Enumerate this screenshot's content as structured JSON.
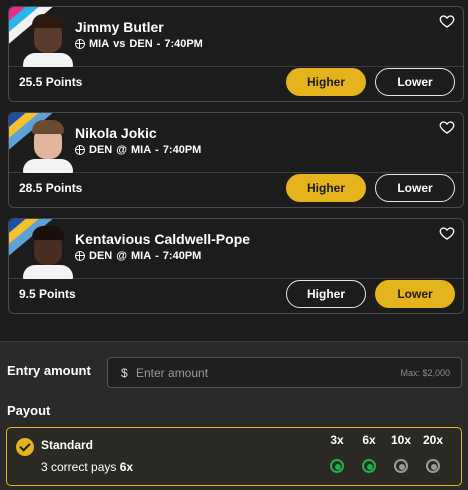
{
  "players": [
    {
      "name": "Jimmy Butler",
      "team": "MIA",
      "sep": "vs",
      "opponent": "DEN",
      "time": "7:40PM",
      "points": "25.5 Points",
      "higher_label": "Higher",
      "lower_label": "Lower",
      "selected": "higher",
      "stripe_colors": [
        "#e62f8a",
        "#29b6e8",
        "#f2f2f2"
      ],
      "skin": "#5a3a2a",
      "hair": "#2a1a12",
      "shirt": "#f4f4f4"
    },
    {
      "name": "Nikola Jokic",
      "team": "DEN",
      "sep": "@",
      "opponent": "MIA",
      "time": "7:40PM",
      "points": "28.5 Points",
      "higher_label": "Higher",
      "lower_label": "Lower",
      "selected": "higher",
      "stripe_colors": [
        "#1d4fa8",
        "#f2c230",
        "#5ea0d8"
      ],
      "skin": "#e2b59a",
      "hair": "#6a4a32",
      "shirt": "#f4f4f4"
    },
    {
      "name": "Kentavious Caldwell-Pope",
      "team": "DEN",
      "sep": "@",
      "opponent": "MIA",
      "time": "7:40PM",
      "points": "9.5 Points",
      "higher_label": "Higher",
      "lower_label": "Lower",
      "selected": "lower",
      "stripe_colors": [
        "#1d4fa8",
        "#f2c230",
        "#5ea0d8"
      ],
      "skin": "#4a2e22",
      "hair": "#1a100c",
      "shirt": "#f4f4f4"
    }
  ],
  "entry": {
    "label": "Entry amount",
    "currency": "$",
    "placeholder": "Enter amount",
    "max": "Max: $2,000"
  },
  "payout": {
    "label": "Payout",
    "plan": "Standard",
    "desc_prefix": "3 correct pays ",
    "desc_value": "6x",
    "multipliers": [
      {
        "label": "3x",
        "active": true
      },
      {
        "label": "6x",
        "active": true
      },
      {
        "label": "10x",
        "active": false
      },
      {
        "label": "20x",
        "active": false
      }
    ]
  },
  "colors": {
    "accent": "#e5b31c",
    "active_dot": "#22b14c",
    "inactive_dot": "#9a9a9a",
    "background": "#1c1c1c"
  },
  "icons": {
    "favorite": "heart-outline-icon",
    "sport": "basketball-icon",
    "selected": "check-circle-icon"
  }
}
